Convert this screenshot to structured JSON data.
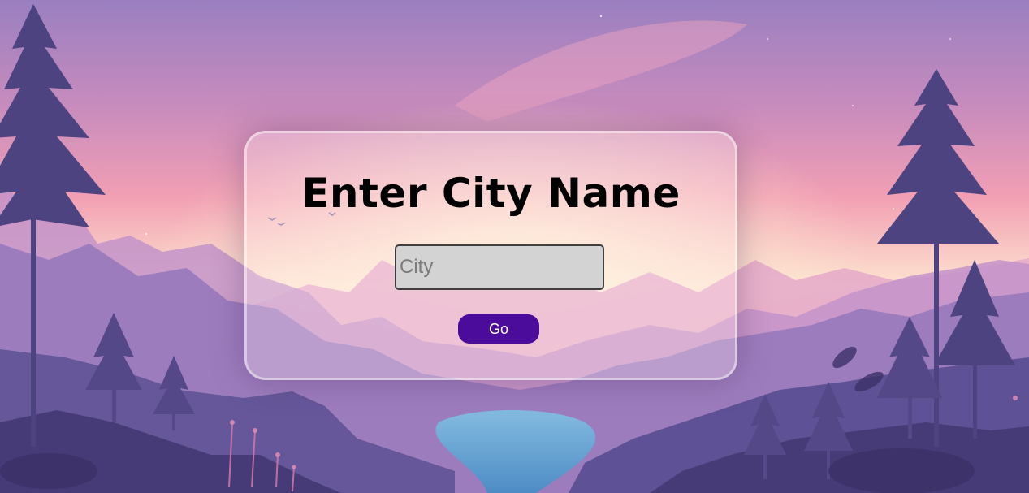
{
  "form": {
    "title": "Enter City Name",
    "city_input_value": "",
    "city_input_placeholder": "City",
    "submit_label": "Go"
  },
  "colors": {
    "sky_top": "#9c80c0",
    "sky_glow": "#f4a0b5",
    "horizon": "#fde8d0",
    "mountain_far": "#d49ac4",
    "mountain_mid": "#9e7bbd",
    "mountain_near": "#5d4c8c",
    "foreground": "#443a72",
    "river": "#5fb4dc",
    "button": "#4b0c9c",
    "input_bg": "#d3d3d3"
  },
  "background": {
    "scene": "purple dusk mountain landscape with pine trees and river",
    "icons": [
      "pine-tree-icon",
      "bird-icon",
      "flower-icon"
    ]
  }
}
